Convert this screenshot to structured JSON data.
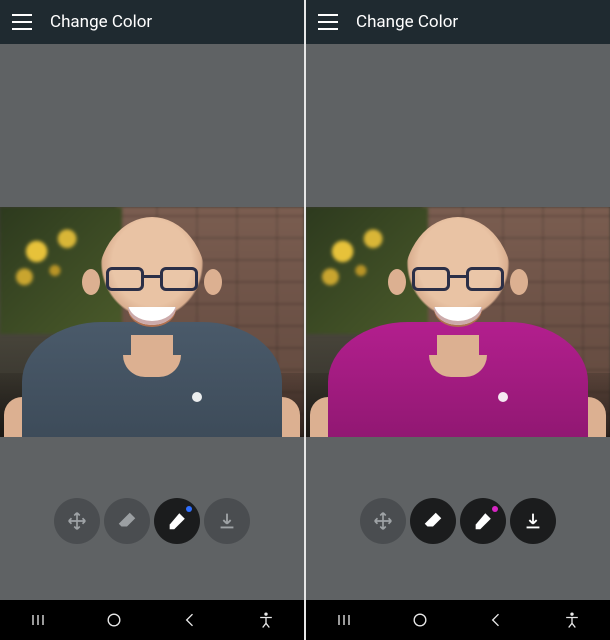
{
  "panes": [
    {
      "title": "Change Color",
      "shirt_color": "#3f4e5c",
      "tool_dot_color": "#2f6fff",
      "tool_style": "dim",
      "tools": {
        "move": "move-icon",
        "eraser": "eraser-icon",
        "brush": "brush-icon",
        "download": "download-icon"
      },
      "nav": {
        "recents": "|||",
        "home": "○",
        "back": "<",
        "accessibility": "person"
      }
    },
    {
      "title": "Change Color",
      "shirt_color": "#a31b82",
      "tool_dot_color": "#d726c4",
      "tool_style": "dark",
      "tools": {
        "move": "move-icon",
        "eraser": "eraser-icon",
        "brush": "brush-icon",
        "download": "download-icon"
      },
      "nav": {
        "recents": "|||",
        "home": "○",
        "back": "<",
        "accessibility": "person"
      }
    }
  ]
}
